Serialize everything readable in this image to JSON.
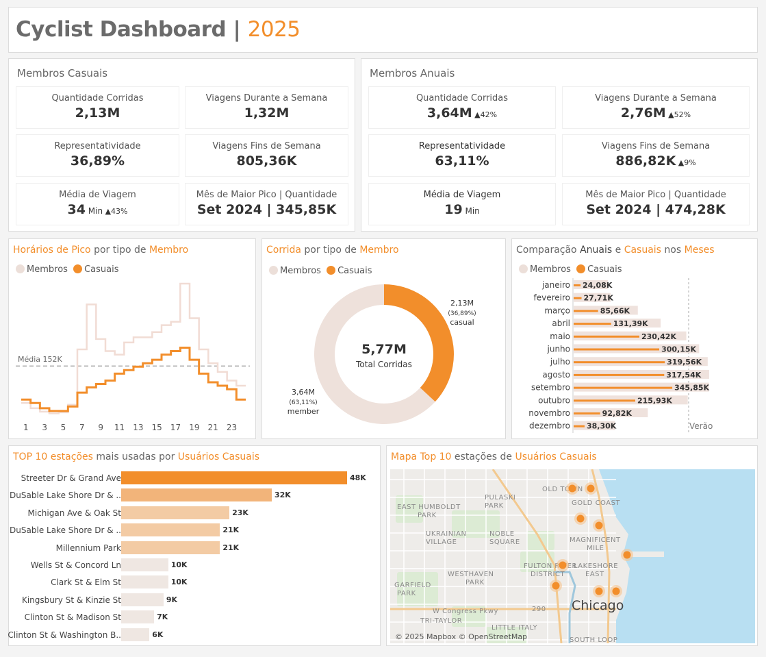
{
  "header": {
    "title": "Cyclist Dashboard |",
    "year": "2025"
  },
  "casual": {
    "title": "Membros Casuais",
    "cards": [
      {
        "label": "Quantidade Corridas",
        "value": "2,13M",
        "unit": "",
        "delta": ""
      },
      {
        "label": "Viagens Durante a Semana",
        "value": "1,32M",
        "unit": "",
        "delta": ""
      },
      {
        "label": "Representatividade",
        "value": "36,89%",
        "unit": "",
        "delta": ""
      },
      {
        "label": "Viagens Fins de Semana",
        "value": "805,36K",
        "unit": "",
        "delta": ""
      },
      {
        "label": "Média de Viagem",
        "value": "34",
        "unit": "Min",
        "delta": "▲43%"
      },
      {
        "label": "Mês de Maior Pico | Quantidade",
        "value": "Set 2024 | 345,85K",
        "unit": "",
        "delta": ""
      }
    ]
  },
  "annual": {
    "title": "Membros Anuais",
    "cards": [
      {
        "label": "Quantidade Corridas",
        "value": "3,64M",
        "unit": "",
        "delta": "▲42%"
      },
      {
        "label": "Viagens Durante a Semana",
        "value": "2,76M",
        "unit": "",
        "delta": "▲52%"
      },
      {
        "label": "Representatividade",
        "value": "63,11%",
        "unit": "",
        "delta": ""
      },
      {
        "label": "Viagens Fins de Semana",
        "value": "886,82K",
        "unit": "",
        "delta": "▲9%"
      },
      {
        "label": "Média de Viagem",
        "value": "19",
        "unit": "Min",
        "delta": ""
      },
      {
        "label": "Mês de Maior Pico | Quantidade",
        "value": "Set 2024 | 474,28K",
        "unit": "",
        "delta": ""
      }
    ]
  },
  "legend": {
    "members": "Membros",
    "casuals": "Casuais"
  },
  "peak": {
    "t1": "Horários de Pico",
    "t2": " por tipo de ",
    "t3": "Membro",
    "avg_label": "Média 152K"
  },
  "donut": {
    "t1": "Corrida",
    "t2": " por tipo de ",
    "t3": "Membro",
    "total": "5,77M",
    "total_label": "Total Corridas",
    "casual_value": "2,13M",
    "casual_pct": "(36,89%)",
    "casual_name": "casual",
    "member_value": "3,64M",
    "member_pct": "(63,11%)",
    "member_name": "member"
  },
  "monthly": {
    "t1": "Comparação ",
    "t2": "Anuais",
    "t3": " e ",
    "t4": "Casuais",
    "t5": " nos ",
    "t6": "Meses",
    "summer_label": "Verão"
  },
  "stations": {
    "t1": "TOP 10 estações",
    "t2": " mais usadas por ",
    "t3": "Usuários Casuais"
  },
  "map": {
    "t1": "Mapa Top 10",
    "t2": " estações de ",
    "t3": "Usuários Casuais",
    "attribution": "© 2025 Mapbox © OpenStreetMap",
    "labels": [
      {
        "text": "OLD TOWN"
      },
      {
        "text": "GOLD COAST"
      },
      {
        "text": "PULASKI"
      },
      {
        "text": "PARK"
      },
      {
        "text": "EAST HUMBOLDT"
      },
      {
        "text": "PARK"
      },
      {
        "text": "UKRAINIAN"
      },
      {
        "text": "VILLAGE"
      },
      {
        "text": "NOBLE"
      },
      {
        "text": "SQUARE"
      },
      {
        "text": "MAGNIFICENT"
      },
      {
        "text": "MILE"
      },
      {
        "text": "FULTON RIVER"
      },
      {
        "text": "DISTRICT"
      },
      {
        "text": "LAKESHORE"
      },
      {
        "text": "EAST"
      },
      {
        "text": "WESTHAVEN"
      },
      {
        "text": "PARK"
      },
      {
        "text": "GARFIELD"
      },
      {
        "text": "PARK"
      },
      {
        "text": "W Congress Pkwy"
      },
      {
        "text": "TRI-TAYLOR"
      },
      {
        "text": "LITTLE ITALY"
      },
      {
        "text": "SOUTH LOOP"
      },
      {
        "text": "Chicago"
      },
      {
        "text": "290"
      }
    ]
  },
  "chart_data": [
    {
      "type": "line",
      "title": "Horários de Pico por tipo de Membro",
      "x": [
        0,
        1,
        2,
        3,
        4,
        5,
        6,
        7,
        8,
        9,
        10,
        11,
        12,
        13,
        14,
        15,
        16,
        17,
        18,
        19,
        20,
        21,
        22,
        23
      ],
      "x_tick_labels": [
        "1",
        "3",
        "5",
        "7",
        "9",
        "11",
        "13",
        "15",
        "17",
        "19",
        "21",
        "23"
      ],
      "series": [
        {
          "name": "Membros",
          "values": [
            45,
            30,
            20,
            15,
            18,
            40,
            200,
            330,
            230,
            195,
            185,
            220,
            235,
            235,
            250,
            270,
            280,
            390,
            290,
            200,
            160,
            135,
            110,
            95
          ]
        },
        {
          "name": "Casuais",
          "values": [
            55,
            45,
            30,
            22,
            22,
            35,
            75,
            90,
            100,
            110,
            130,
            140,
            150,
            160,
            170,
            185,
            195,
            205,
            170,
            130,
            105,
            95,
            85,
            55
          ]
        }
      ],
      "reference_line": 152
    },
    {
      "type": "pie",
      "title": "Corrida por tipo de Membro",
      "categories": [
        "casual",
        "member"
      ],
      "values": [
        2.13,
        3.64
      ],
      "percent": [
        36.89,
        63.11
      ]
    },
    {
      "type": "bar",
      "title": "Comparação Anuais e Casuais nos Meses",
      "categories": [
        "janeiro",
        "fevereiro",
        "março",
        "abril",
        "maio",
        "junho",
        "julho",
        "agosto",
        "setembro",
        "outubro",
        "novembro",
        "dezembro"
      ],
      "series": [
        {
          "name": "Membros",
          "values": [
            120,
            130,
            225,
            305,
            395,
            440,
            470,
            475,
            474.28,
            400,
            260,
            145
          ]
        },
        {
          "name": "Casuais",
          "values": [
            24.08,
            27.71,
            85.66,
            131.39,
            230.42,
            300.15,
            319.56,
            317.54,
            345.85,
            215.93,
            92.82,
            38.3
          ]
        }
      ],
      "data_labels": [
        "24,08K",
        "27,71K",
        "85,66K",
        "131,39K",
        "230,42K",
        "300,15K",
        "319,56K",
        "317,54K",
        "345,85K",
        "215,93K",
        "92,82K",
        "38,30K"
      ]
    },
    {
      "type": "bar",
      "title": "TOP 10 estações mais usadas por Usuários Casuais",
      "categories": [
        "Streeter Dr & Grand Ave",
        "DuSable Lake Shore Dr & ..",
        "Michigan Ave & Oak St",
        "DuSable Lake Shore Dr & ..",
        "Millennium Park",
        "Wells St & Concord Ln",
        "Clark St & Elm St",
        "Kingsbury St & Kinzie St",
        "Clinton St & Madison St",
        "Clinton St & Washington B.."
      ],
      "values": [
        48,
        32,
        23,
        21,
        21,
        10,
        10,
        9,
        7,
        6
      ],
      "data_labels": [
        "48K",
        "32K",
        "23K",
        "21K",
        "21K",
        "10K",
        "10K",
        "9K",
        "7K",
        "6K"
      ],
      "colors": [
        "#f28e2b",
        "#f2b47a",
        "#f3cba4",
        "#f3cba4",
        "#f3cba4",
        "#efe7e2",
        "#efe7e2",
        "#efe7e2",
        "#efe7e2",
        "#efe7e2"
      ]
    }
  ]
}
